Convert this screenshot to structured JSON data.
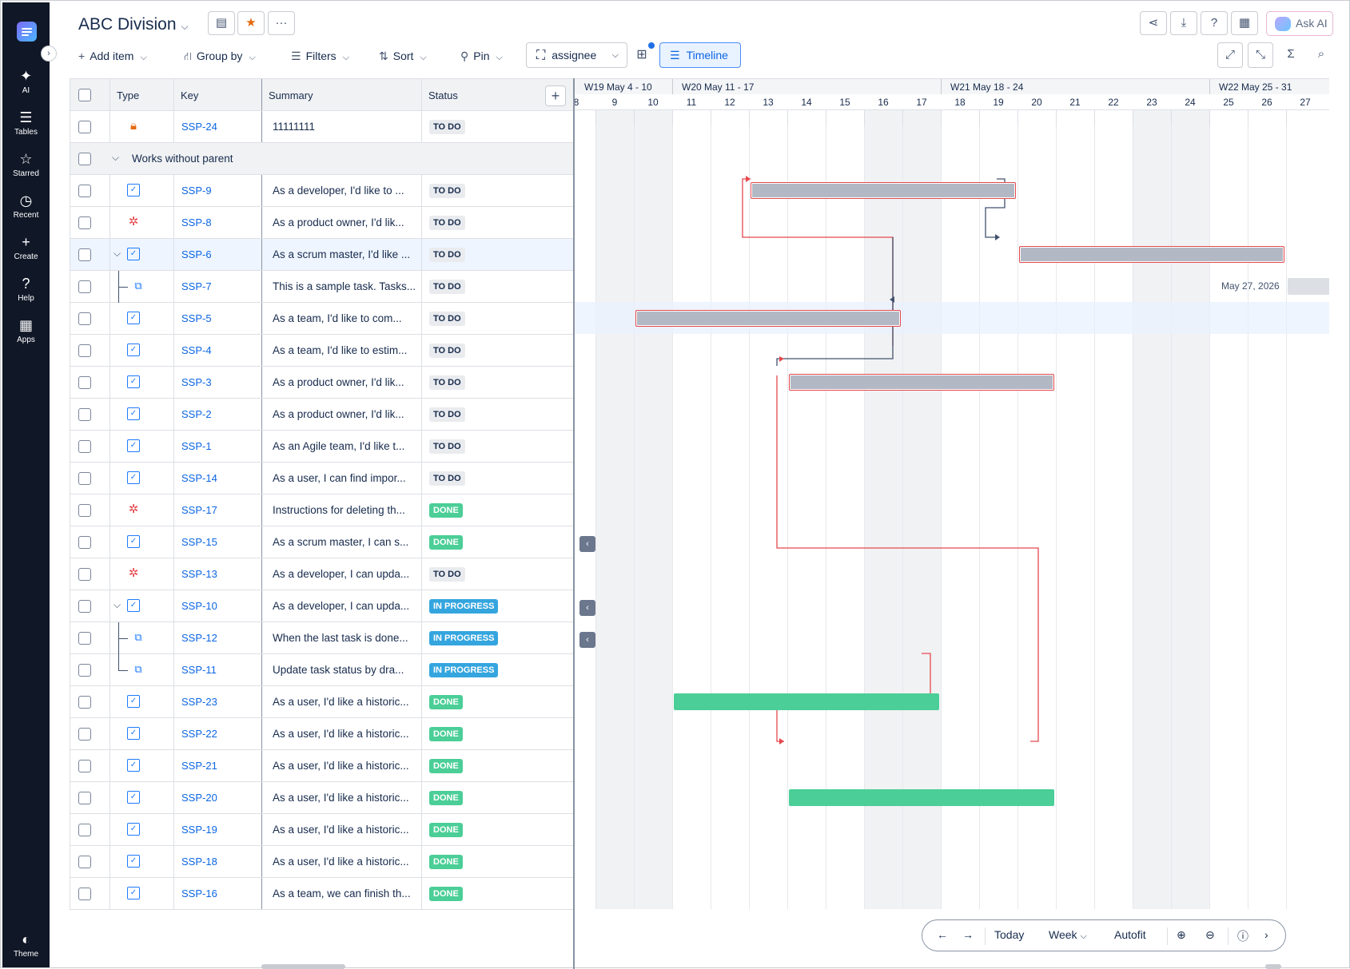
{
  "rail": {
    "items": [
      {
        "name": "ai",
        "icon": "sparkle-icon",
        "glyph": "✦",
        "label": "AI"
      },
      {
        "name": "tables",
        "icon": "tables-icon",
        "glyph": "☰",
        "label": "Tables"
      },
      {
        "name": "starred",
        "icon": "star-icon",
        "glyph": "☆",
        "label": "Starred"
      },
      {
        "name": "recent",
        "icon": "clock-icon",
        "glyph": "◷",
        "label": "Recent"
      },
      {
        "name": "create",
        "icon": "plus-icon",
        "glyph": "+",
        "label": "Create"
      },
      {
        "name": "help",
        "icon": "help-icon",
        "glyph": "?",
        "label": "Help"
      },
      {
        "name": "apps",
        "icon": "apps-icon",
        "glyph": "▦",
        "label": "Apps"
      }
    ],
    "theme_label": "Theme"
  },
  "header": {
    "title": "ABC Division",
    "ask_ai": "Ask AI"
  },
  "toolbar": {
    "add_item": "Add item",
    "group_by": "Group by",
    "filters": "Filters",
    "sort": "Sort",
    "pin": "Pin",
    "assignee": "assignee",
    "timeline": "Timeline"
  },
  "grid": {
    "columns": [
      "Type",
      "Key",
      "Summary",
      "Status"
    ],
    "group_label": "Works without parent",
    "rows": [
      {
        "type": "lock",
        "key": "SSP-24",
        "summary": "11111111",
        "status": "TO DO"
      },
      {
        "group": true
      },
      {
        "type": "story",
        "key": "SSP-9",
        "summary": "As a developer, I'd like to ...",
        "status": "TO DO"
      },
      {
        "type": "bug",
        "key": "SSP-8",
        "summary": "As a product owner, I'd lik...",
        "status": "TO DO"
      },
      {
        "type": "story",
        "key": "SSP-6",
        "summary": "As a scrum master, I'd like ...",
        "status": "TO DO",
        "expand": true,
        "selected": true
      },
      {
        "type": "subtask",
        "key": "SSP-7",
        "summary": "This is a sample task. Tasks...",
        "status": "TO DO",
        "child": true
      },
      {
        "type": "story",
        "key": "SSP-5",
        "summary": "As a team, I'd like to com...",
        "status": "TO DO"
      },
      {
        "type": "story",
        "key": "SSP-4",
        "summary": "As a team, I'd like to estim...",
        "status": "TO DO"
      },
      {
        "type": "story",
        "key": "SSP-3",
        "summary": "As a product owner, I'd lik...",
        "status": "TO DO"
      },
      {
        "type": "story",
        "key": "SSP-2",
        "summary": "As a product owner, I'd lik...",
        "status": "TO DO"
      },
      {
        "type": "story",
        "key": "SSP-1",
        "summary": "As an Agile team, I'd like t...",
        "status": "TO DO"
      },
      {
        "type": "story",
        "key": "SSP-14",
        "summary": "As a user, I can find impor...",
        "status": "TO DO"
      },
      {
        "type": "bug",
        "key": "SSP-17",
        "summary": "Instructions for deleting th...",
        "status": "DONE"
      },
      {
        "type": "story",
        "key": "SSP-15",
        "summary": "As a scrum master, I can s...",
        "status": "DONE"
      },
      {
        "type": "bug",
        "key": "SSP-13",
        "summary": "As a developer, I can upda...",
        "status": "TO DO"
      },
      {
        "type": "story",
        "key": "SSP-10",
        "summary": "As a developer, I can upda...",
        "status": "IN PROGRESS",
        "expand": true
      },
      {
        "type": "subtask",
        "key": "SSP-12",
        "summary": "When the last task is done...",
        "status": "IN PROGRESS",
        "child": true
      },
      {
        "type": "subtask",
        "key": "SSP-11",
        "summary": "Update task status by dra...",
        "status": "IN PROGRESS",
        "child": true,
        "last_child": true
      },
      {
        "type": "story",
        "key": "SSP-23",
        "summary": "As a user, I'd like a historic...",
        "status": "DONE"
      },
      {
        "type": "story",
        "key": "SSP-22",
        "summary": "As a user, I'd like a historic...",
        "status": "DONE"
      },
      {
        "type": "story",
        "key": "SSP-21",
        "summary": "As a user, I'd like a historic...",
        "status": "DONE"
      },
      {
        "type": "story",
        "key": "SSP-20",
        "summary": "As a user, I'd like a historic...",
        "status": "DONE"
      },
      {
        "type": "story",
        "key": "SSP-19",
        "summary": "As a user, I'd like a historic...",
        "status": "DONE"
      },
      {
        "type": "story",
        "key": "SSP-18",
        "summary": "As a user, I'd like a historic...",
        "status": "DONE"
      },
      {
        "type": "story",
        "key": "SSP-16",
        "summary": "As a team, we can finish th...",
        "status": "DONE"
      }
    ]
  },
  "timeline": {
    "weeks": [
      "W19 May 4 - 10",
      "W20 May 11 - 17",
      "W21 May 18 - 24",
      "W22 May 25 - 31"
    ],
    "days": [
      "8",
      "9",
      "10",
      "11",
      "12",
      "13",
      "14",
      "15",
      "16",
      "17",
      "18",
      "19",
      "20",
      "21",
      "22",
      "23",
      "24",
      "25",
      "26",
      "27"
    ],
    "weekend_days": [
      "9",
      "10",
      "16",
      "17",
      "23",
      "24"
    ],
    "bars": [
      {
        "key": "SSP-9",
        "start": "13",
        "end": "19",
        "color": "gray"
      },
      {
        "key": "SSP-6",
        "start": "20",
        "end": "26",
        "color": "gray"
      },
      {
        "key": "SSP-5",
        "start": "10",
        "end": "16",
        "color": "gray"
      },
      {
        "key": "SSP-3",
        "start": "14",
        "end": "20",
        "color": "gray"
      },
      {
        "key": "SSP-23",
        "start": "11",
        "end": "17",
        "color": "green"
      },
      {
        "key": "SSP-20",
        "start": "14",
        "end": "20",
        "color": "green"
      }
    ],
    "ssp7_date": "May 27, 2026",
    "nav": {
      "today": "Today",
      "scale": "Week",
      "autofit": "Autofit"
    }
  },
  "colors": {
    "accent": "#0c66e4",
    "done": "#4bce97",
    "in_progress": "#34a5de",
    "link": "#e5484d"
  }
}
